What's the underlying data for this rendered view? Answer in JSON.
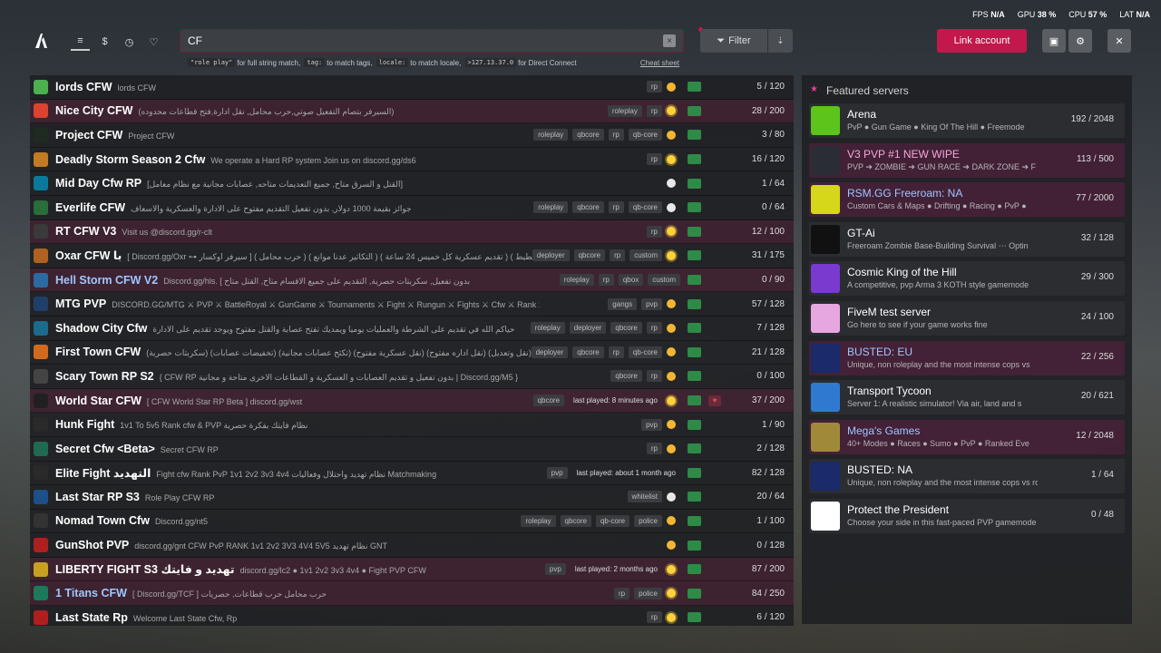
{
  "stats": {
    "fps_label": "FPS",
    "fps_value": "N/A",
    "gpu_label": "GPU",
    "gpu_value": "38 %",
    "cpu_label": "CPU",
    "cpu_value": "57 %",
    "lat_label": "LAT",
    "lat_value": "N/A"
  },
  "search": {
    "value": "CF",
    "clear_icon": "×"
  },
  "hint": {
    "t1": "\"role play\"",
    "d1": "for full string match,",
    "t2": "tag:",
    "d2": "to match tags,",
    "t3": "locale:",
    "d3": "to match locale,",
    "t4": ">127.13.37.0",
    "d4": "for Direct Connect",
    "cheat": "Cheat sheet"
  },
  "toolbar": {
    "filter_label": "Filter",
    "link_label": "Link account"
  },
  "servers": [
    {
      "name": "lords CFW",
      "desc": "lords CFW",
      "tags": [
        "rp"
      ],
      "last": "",
      "sun": "y",
      "count": "5 / 120",
      "icon": "#4caf50",
      "hl": false
    },
    {
      "name": "Nice City CFW",
      "desc": "(السيرفر بتصام التفعيل صوتي,حرب محامل, نقل ادارة,فتح قطاعات محدوده)",
      "tags": [
        "roleplay",
        "rp"
      ],
      "last": "",
      "sun": "s",
      "count": "28 / 200",
      "icon": "#d9432f",
      "hl": true
    },
    {
      "name": "Project CFW",
      "desc": "Project CFW",
      "tags": [
        "roleplay",
        "qbcore",
        "rp",
        "qb-core"
      ],
      "last": "",
      "sun": "y",
      "count": "3 / 80",
      "icon": "#1f2a22",
      "hl": false
    },
    {
      "name": "Deadly Storm Season 2 Cfw",
      "desc": "We operate a Hard RP system Join us on discord.gg/ds6",
      "tags": [
        "rp"
      ],
      "last": "",
      "sun": "s",
      "count": "16 / 120",
      "icon": "#c27a24",
      "hl": false
    },
    {
      "name": "Mid Day Cfw RP",
      "desc": "[القتل و السرق متاح, جميع التعديمات متاحه, عصابات مجانية مع نظام معامل]",
      "tags": [],
      "last": "",
      "sun": "w",
      "count": "1 / 64",
      "icon": "#0b7a9a",
      "hl": false
    },
    {
      "name": "Everlife CFW",
      "desc": "جوائز بقيمة 1000 دولار, بدون تفعيل التقديم مفتوح على الادارة والعسكرية والاسعاف",
      "tags": [
        "roleplay",
        "qbcore",
        "rp",
        "qb-core"
      ],
      "last": "",
      "sun": "w",
      "count": "0 / 64",
      "icon": "#2a6e3c",
      "hl": false
    },
    {
      "name": "RT CFW V3",
      "desc": "Visit us @discord.gg/r-clt",
      "tags": [
        "rp"
      ],
      "last": "",
      "sun": "s",
      "count": "12 / 100",
      "icon": "#3a3a3a",
      "hl": true
    },
    {
      "name": "Oxar CFW با",
      "desc": "[ Discord.gg/Oxr ⊶ سيرفر اوكسار ] ( حرب محامل ) ( التكاثير عدنا موانع ) ( تقديم عسكرية كل خميس 24 ساعة ) ( تسطيط",
      "tags": [
        "deployer",
        "qbcore",
        "rp",
        "custom"
      ],
      "last": "",
      "sun": "s",
      "count": "31 / 175",
      "icon": "#b06020",
      "hl": false
    },
    {
      "name": "Hell Storm CFW V2",
      "desc": "Discord.gg/hls. [ بدون تفعيل, سكربتات حصرية, التقديم على جميع الاقسام متاح, القتل متاح",
      "tags": [
        "roleplay",
        "rp",
        "qbox",
        "custom"
      ],
      "last": "",
      "sun": "",
      "count": "0 / 90",
      "icon": "#2b6ca0",
      "hl": true,
      "blue": true
    },
    {
      "name": "MTG PVP",
      "desc": "DISCORD.GG/MTG ⚔ PVP ⚔ BattleRoyal ⚔ GunGame ⚔ Tournaments ⚔ Fight ⚔ Rungun ⚔ Fights ⚔ Cfw ⚔ Rank 1v1 2v2 10v",
      "tags": [
        "gangs",
        "pvp"
      ],
      "last": "",
      "sun": "y",
      "count": "57 / 128",
      "icon": "#1f3f6a",
      "hl": false
    },
    {
      "name": "Shadow City Cfw",
      "desc": "حياكم الله في تقديم على الشرطة والعمليات يوميا ويمديك تفتح عصابة والقتل مفتوح ويوجد تقديم على الادارة",
      "tags": [
        "roleplay",
        "deployer",
        "qbcore",
        "rp"
      ],
      "last": "",
      "sun": "y",
      "count": "7 / 128",
      "icon": "#1c6a8c",
      "hl": false
    },
    {
      "name": "First Town CFW",
      "desc": "(سكربتات حصرية) (تخفيضات عصابات) (تكثح عصابات مجانية) (نقل عسكرية مفتوح) (نقل اداره مفتوح) (نقل وتعديل)",
      "tags": [
        "deployer",
        "qbcore",
        "rp",
        "qb-core"
      ],
      "last": "",
      "sun": "y",
      "count": "21 / 128",
      "icon": "#d26a1e",
      "hl": false
    },
    {
      "name": "Scary Town RP S2",
      "desc": "{ CFW RP بدون تفعيل و تقديم العصابات و العسكرية و القطاعات الاخرى متاحة و مجانية | Discord.gg/M5 }",
      "tags": [
        "qbcore",
        "rp"
      ],
      "last": "",
      "sun": "y",
      "count": "0 / 100",
      "icon": "#444",
      "hl": false
    },
    {
      "name": "World Star CFW",
      "desc": "[ CFW World Star RP Beta ] discord.gg/wst",
      "tags": [
        "qbcore"
      ],
      "last": "last played: 8 minutes ago",
      "sun": "s",
      "count": "37 / 200",
      "icon": "#202020",
      "hl": true,
      "heart": true
    },
    {
      "name": "Hunk Fight",
      "desc": "1v1 To 5v5 Rank cfw & PVP نظام فايتك بفكرة حصرية",
      "tags": [
        "pvp"
      ],
      "last": "",
      "sun": "y",
      "count": "1 / 90",
      "icon": "#2a2a2a",
      "hl": false
    },
    {
      "name": "Secret Cfw <Beta>",
      "desc": "Secret CFW RP",
      "tags": [
        "rp"
      ],
      "last": "",
      "sun": "y",
      "count": "2 / 128",
      "icon": "#1f6a50",
      "hl": false
    },
    {
      "name": "Elite Fight التهديد",
      "desc": "Fight cfw Rank PvP 1v1 2v2 3v3 4v4 نظام تهديد واحتلال وفعاليات Matchmaking",
      "tags": [
        "pvp"
      ],
      "last": "last played: about 1 month ago",
      "sun": "",
      "count": "82 / 128",
      "icon": "#2a2a2a",
      "hl": false
    },
    {
      "name": "Last Star RP S3",
      "desc": "Role Play CFW RP",
      "tags": [
        "whitelist"
      ],
      "last": "",
      "sun": "w",
      "count": "20 / 64",
      "icon": "#1d4f8a",
      "hl": false
    },
    {
      "name": "Nomad Town Cfw",
      "desc": "Discord.gg/nt5",
      "tags": [
        "roleplay",
        "qbcore",
        "qb-core",
        "police"
      ],
      "last": "",
      "sun": "y",
      "count": "1 / 100",
      "icon": "#333",
      "hl": false
    },
    {
      "name": "GunShot PVP",
      "desc": "discord.gg/gnt CFW PvP RANK 1v1 2v2 3V3 4V4 5V5 نظام تهديد GNT",
      "tags": [],
      "last": "",
      "sun": "y",
      "count": "0 / 128",
      "icon": "#b01f1f",
      "hl": false
    },
    {
      "name": "LIBERTY FIGHT S3 تهديد و فايتك",
      "desc": "discord.gg/lc2 ● 1v1 2v2 3v3 4v4 ● Fight PVP CFW",
      "tags": [
        "pvp"
      ],
      "last": "last played: 2 months ago",
      "sun": "s",
      "count": "87 / 200",
      "icon": "#c8a020",
      "hl": true
    },
    {
      "name": "1 Titans CFW",
      "desc": "[ Discord.gg/TCF ] حرب محامل حرب قطاعات, حصريات",
      "tags": [
        "rp",
        "police"
      ],
      "last": "",
      "sun": "s",
      "count": "84 / 250",
      "icon": "#1a7a5a",
      "hl": true,
      "blue": true
    },
    {
      "name": "Last State Rp",
      "desc": "Welcome Last State Cfw, Rp",
      "tags": [
        "rp"
      ],
      "last": "",
      "sun": "s",
      "count": "6 / 120",
      "icon": "#b01f1f",
      "hl": false
    }
  ],
  "featured": {
    "title": "Featured servers",
    "items": [
      {
        "name": "Arena",
        "desc": "PvP ● Gun Game ● King Of The Hill ● Freemode",
        "count": "192 / 2048",
        "color": "#5cc41a",
        "style": "",
        "hl": false
      },
      {
        "name": "V3 PVP #1 NEW WIPE",
        "desc": "PVP ➔ ZOMBIE ➔ GUN RACE ➔ DARK ZONE ➔ F",
        "count": "113 / 500",
        "color": "#2a2d36",
        "style": "pink",
        "hl": true
      },
      {
        "name": "RSM.GG Freeroam: NA",
        "desc": "Custom Cars & Maps ● Drifting ● Racing ● PvP ●",
        "count": "77 / 2000",
        "color": "#d6d61a",
        "style": "blue",
        "hl": true
      },
      {
        "name": "GT-Ai",
        "desc": "Freeroam Zombie Base-Building Survival ⋯ Optin",
        "count": "32 / 128",
        "color": "#111",
        "style": "",
        "hl": false
      },
      {
        "name": "Cosmic King of the Hill",
        "desc": "A competitive, pvp Arma 3 KOTH style gamemode",
        "count": "29 / 300",
        "color": "#7a3ad0",
        "style": "",
        "hl": false
      },
      {
        "name": "FiveM test server",
        "desc": "Go here to see if your game works fine",
        "count": "24 / 100",
        "color": "#e6a6e0",
        "style": "",
        "hl": false
      },
      {
        "name": "BUSTED: EU",
        "desc": "Unique, non roleplay and the most intense cops vs",
        "count": "22 / 256",
        "color": "#1a2a6a",
        "style": "blue",
        "hl": true
      },
      {
        "name": "Transport Tycoon",
        "desc": "Server 1: A realistic simulator! Via air, land and s",
        "count": "20 / 621",
        "color": "#2f7ad0",
        "style": "",
        "hl": false
      },
      {
        "name": "Mega's Games",
        "desc": "40+ Modes ● Races ● Sumo ● PvP ● Ranked Eve",
        "count": "12 / 2048",
        "color": "#a08a3a",
        "style": "blue",
        "hl": true
      },
      {
        "name": "BUSTED: NA",
        "desc": "Unique, non roleplay and the most intense cops vs ro",
        "count": "1 / 64",
        "color": "#1a2a6a",
        "style": "",
        "hl": false
      },
      {
        "name": "Protect the President",
        "desc": "Choose your side in this fast-paced PVP gamemode",
        "count": "0 / 48",
        "color": "#ffffff",
        "style": "",
        "hl": false
      }
    ]
  }
}
